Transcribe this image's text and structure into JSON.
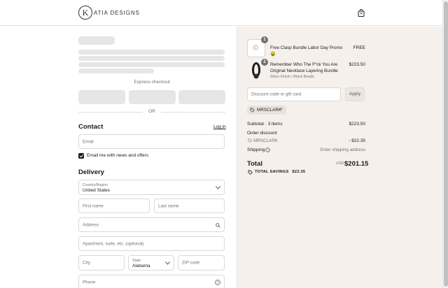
{
  "brand": {
    "mark": "K",
    "name": "ATIA DESIGNS"
  },
  "header": {
    "cart_icon": "shopping-bag-icon"
  },
  "express": {
    "label": "Express checkout",
    "or_label": "OR"
  },
  "contact": {
    "title": "Contact",
    "login_label": "Log in",
    "email_placeholder": "Email",
    "newsletter_label": "Email me with news and offers",
    "newsletter_checked": true
  },
  "delivery": {
    "title": "Delivery",
    "country_label": "Country/Region",
    "country_value": "United States",
    "first_name_placeholder": "First name",
    "last_name_placeholder": "Last name",
    "address_placeholder": "Address",
    "apartment_placeholder": "Apartment, suite, etc. (optional)",
    "city_placeholder": "City",
    "state_label": "State",
    "state_value": "Alabama",
    "zip_placeholder": "ZIP code",
    "phone_placeholder": "Phone"
  },
  "cart": {
    "items": [
      {
        "quantity": "1",
        "name": "Free Clasp Bundle Labor Day Promo 🤑",
        "variant": "",
        "price": "FREE"
      },
      {
        "quantity": "2",
        "name_line1": "Remember Who The F*ck You Are",
        "name_line2": "Original Necklace Layering Bundle",
        "variant": "Silver Finish / Black Beads",
        "price": "$223.50"
      }
    ],
    "discount_placeholder": "Discount code or gift card",
    "apply_label": "Apply",
    "applied_code": "MRSCLARK"
  },
  "summary": {
    "subtotal_label": "Subtotal · 3 items",
    "subtotal_value": "$223.50",
    "order_discount_label": "Order discount",
    "discount_code": "MRSCLARK",
    "discount_value": "- $22.35",
    "shipping_label": "Shipping",
    "shipping_value": "Enter shipping address",
    "total_label": "Total",
    "currency": "USD",
    "total_value": "$201.15",
    "savings_label": "TOTAL SAVINGS",
    "savings_value": "$22.35"
  },
  "colors": {
    "summary_bg": "#f5f0ec",
    "text": "#1a1a1a",
    "muted": "#737373",
    "skeleton": "#e6e6e6"
  }
}
